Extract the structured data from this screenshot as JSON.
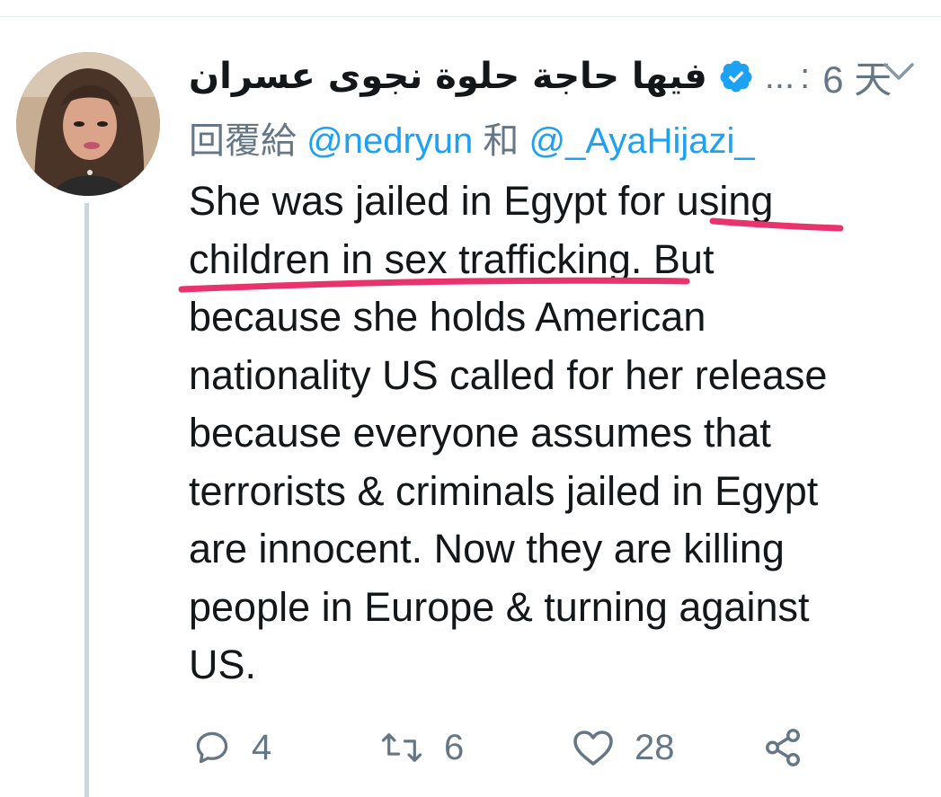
{
  "tweet": {
    "display_name": "فيها حاجة حلوة نجوى عسران",
    "verified": true,
    "handle_truncated": "...",
    "separator": ":",
    "time": "6 天",
    "reply_prefix": "回覆給",
    "reply_mention_1": "@nedryun",
    "reply_conjunction": "和",
    "reply_mention_2": "@_AyaHijazi_",
    "text": "She was jailed in Egypt for using\nchildren in sex trafficking. But\nbecause she holds American\nnationality US called for her release\nbecause everyone assumes that\nterrorists & criminals jailed in Egypt\nare innocent. Now they are killing\npeople in Europe & turning against\nUS."
  },
  "actions": {
    "reply_count": "4",
    "retweet_count": "6",
    "like_count": "28"
  },
  "icons": {
    "verified": "verified-badge-icon",
    "more": "chevron-down-icon",
    "reply": "reply-bubble-icon",
    "retweet": "retweet-icon",
    "like": "heart-icon",
    "share": "share-icon"
  },
  "colors": {
    "accent": "#1da1f2",
    "secondary_text": "#657786",
    "underline_annotation": "#e8336d"
  }
}
